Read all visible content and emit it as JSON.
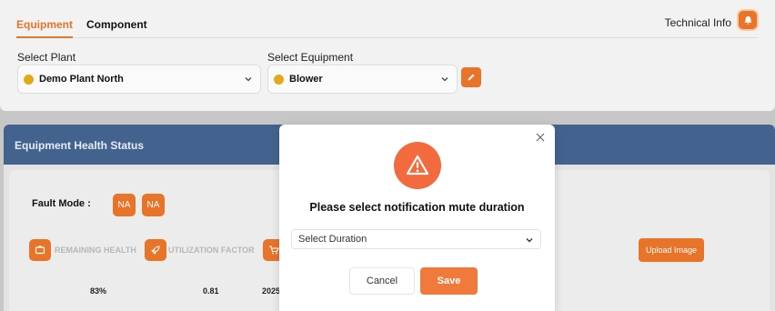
{
  "tabs": [
    {
      "label": "Equipment",
      "active": true
    },
    {
      "label": "Component",
      "active": false
    }
  ],
  "header": {
    "technical_info": "Technical Info"
  },
  "plant": {
    "label": "Select Plant",
    "value": "Demo Plant North"
  },
  "equipment": {
    "label": "Select Equipment",
    "value": "Blower"
  },
  "health": {
    "title": "Equipment Health Status",
    "fault_mode_label": "Fault Mode :",
    "fault_badges": [
      "NA",
      "NA"
    ],
    "metrics": [
      {
        "label": "REMAINING HEALTH",
        "value": "83%",
        "icon": "battery-icon"
      },
      {
        "label": "UTILIZATION FACTOR",
        "value": "0.81",
        "icon": "rocket-icon"
      },
      {
        "label": "",
        "value": "2025",
        "icon": "cart-icon"
      }
    ],
    "upload_label": "Upload Image"
  },
  "modal": {
    "title": "Please select notification mute duration",
    "select_placeholder": "Select Duration",
    "cancel_label": "Cancel",
    "save_label": "Save"
  },
  "colors": {
    "accent": "#e8742a",
    "header_blue": "#43638e",
    "warning": "#f26a3d",
    "status_dot": "#e3a91b"
  }
}
